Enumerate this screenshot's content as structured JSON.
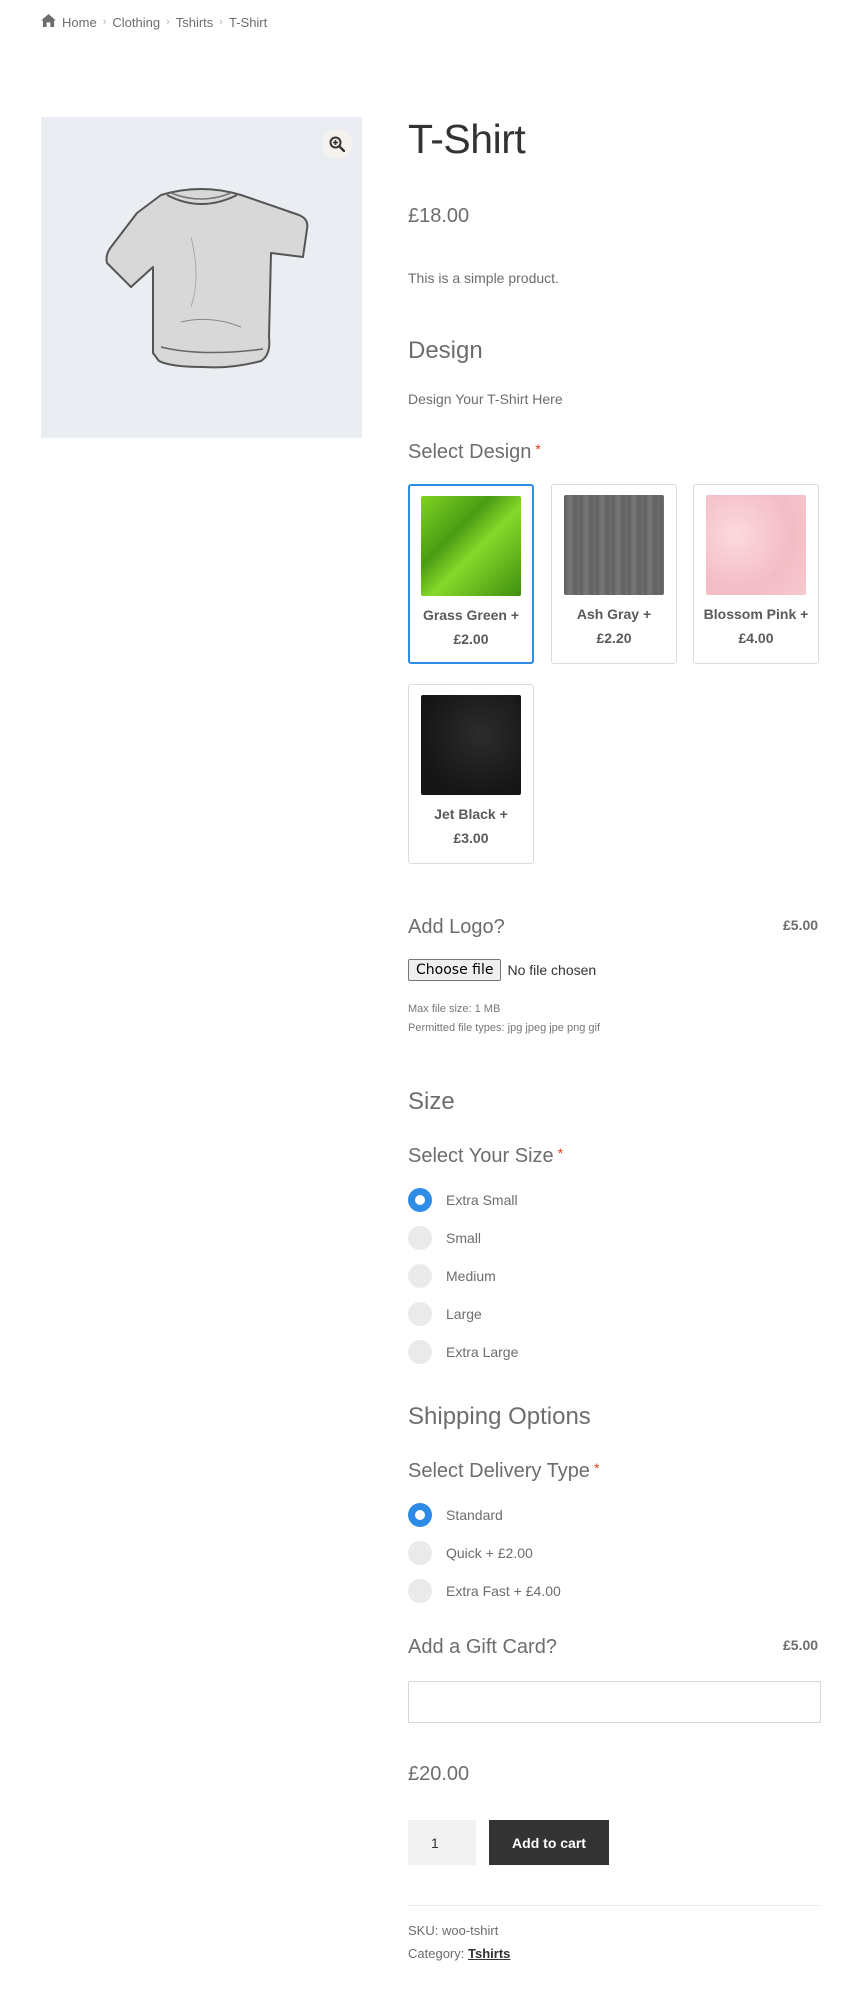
{
  "breadcrumb": {
    "items": [
      "Home",
      "Clothing",
      "Tshirts",
      "T-Shirt"
    ]
  },
  "product": {
    "title": "T-Shirt",
    "price": "£18.00",
    "description": "This is a simple product."
  },
  "design": {
    "section_title": "Design",
    "subtitle": "Design Your T-Shirt Here",
    "field_label": "Select Design",
    "required_mark": "*",
    "options": [
      {
        "name": "Grass Green +",
        "price": "£2.00",
        "color": "#5cb81f",
        "selected": true
      },
      {
        "name": "Ash Gray +",
        "price": "£2.20",
        "color": "#6e6e6e",
        "selected": false
      },
      {
        "name": "Blossom Pink +",
        "price": "£4.00",
        "color": "#f6c4cc",
        "selected": false
      },
      {
        "name": "Jet Black +",
        "price": "£3.00",
        "color": "#1f1f1f",
        "selected": false
      }
    ]
  },
  "logo": {
    "label": "Add Logo?",
    "price": "£5.00",
    "button": "Choose file",
    "status": "No file chosen",
    "max_size": "Max file size: 1 MB",
    "permitted": "Permitted file types: jpg jpeg jpe png gif"
  },
  "size": {
    "section_title": "Size",
    "field_label": "Select Your Size",
    "required_mark": "*",
    "options": [
      "Extra Small",
      "Small",
      "Medium",
      "Large",
      "Extra Large"
    ],
    "selected_index": 0
  },
  "shipping": {
    "section_title": "Shipping Options",
    "field_label": "Select Delivery Type",
    "required_mark": "*",
    "options": [
      "Standard",
      "Quick + £2.00",
      "Extra Fast + £4.00"
    ],
    "selected_index": 0
  },
  "gift": {
    "label": "Add a Gift Card?",
    "price": "£5.00",
    "value": ""
  },
  "total": "£20.00",
  "cart": {
    "quantity": "1",
    "button": "Add to cart"
  },
  "meta": {
    "sku_label": "SKU:",
    "sku": "woo-tshirt",
    "category_label": "Category:",
    "category": "Tshirts"
  },
  "colors": {
    "accent": "#2e8be6",
    "dark_button": "#333333",
    "image_bg": "#eaeef2"
  }
}
